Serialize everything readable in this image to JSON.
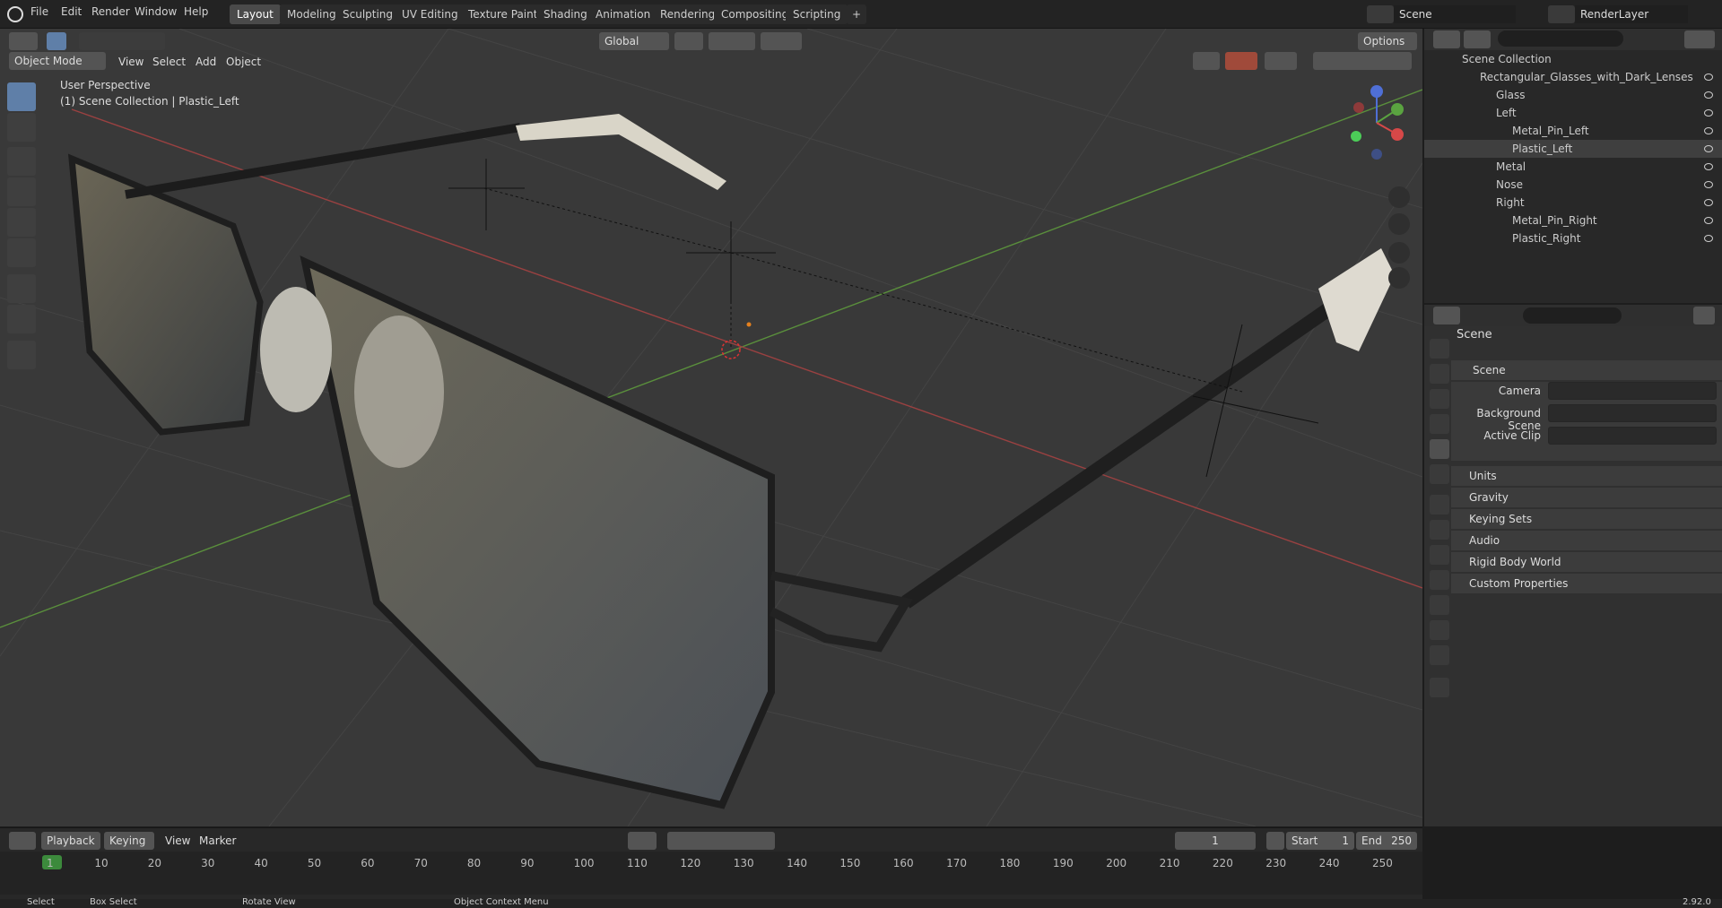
{
  "menus": [
    "File",
    "Edit",
    "Render",
    "Window",
    "Help"
  ],
  "workspaces": [
    "Layout",
    "Modeling",
    "Sculpting",
    "UV Editing",
    "Texture Paint",
    "Shading",
    "Animation",
    "Rendering",
    "Compositing",
    "Scripting"
  ],
  "scene_name": "Scene",
  "render_layer": "RenderLayer",
  "header": {
    "mode": "Object Mode",
    "view": "View",
    "select": "Select",
    "add": "Add",
    "object": "Object",
    "orientation": "Global",
    "options": "Options"
  },
  "viewport": {
    "perspective": "User Perspective",
    "context": "(1) Scene Collection | Plastic_Left"
  },
  "outliner": {
    "root": "Scene Collection",
    "rows": [
      {
        "label": "Rectangular_Glasses_with_Dark_Lenses",
        "indent": 1
      },
      {
        "label": "Glass",
        "indent": 2
      },
      {
        "label": "Left",
        "indent": 2
      },
      {
        "label": "Metal_Pin_Left",
        "indent": 3
      },
      {
        "label": "Plastic_Left",
        "indent": 3
      },
      {
        "label": "Metal",
        "indent": 2
      },
      {
        "label": "Nose",
        "indent": 2
      },
      {
        "label": "Right",
        "indent": 2
      },
      {
        "label": "Metal_Pin_Right",
        "indent": 3
      },
      {
        "label": "Plastic_Right",
        "indent": 3
      }
    ]
  },
  "properties": {
    "title": "Scene",
    "section": "Scene",
    "fields": {
      "camera": "Camera",
      "background_scene": "Background Scene",
      "active_clip": "Active Clip"
    },
    "panels": [
      "Units",
      "Gravity",
      "Keying Sets",
      "Audio",
      "Rigid Body World",
      "Custom Properties"
    ]
  },
  "timeline": {
    "playback": "Playback",
    "keying": "Keying",
    "view": "View",
    "marker": "Marker",
    "current_frame": "1",
    "start_label": "Start",
    "start": "1",
    "end_label": "End",
    "end": "250",
    "ticks": [
      "1",
      "10",
      "20",
      "30",
      "40",
      "50",
      "60",
      "70",
      "80",
      "90",
      "100",
      "110",
      "120",
      "130",
      "140",
      "150",
      "160",
      "170",
      "180",
      "190",
      "200",
      "210",
      "220",
      "230",
      "240",
      "250"
    ]
  },
  "status": {
    "select": "Select",
    "box_select": "Box Select",
    "rotate_view": "Rotate View",
    "context_menu": "Object Context Menu",
    "version": "2.92.0"
  },
  "colors": {
    "accent": "#e4801e",
    "active_tab": "#4a4a4a",
    "selection": "#5f7fa8"
  }
}
